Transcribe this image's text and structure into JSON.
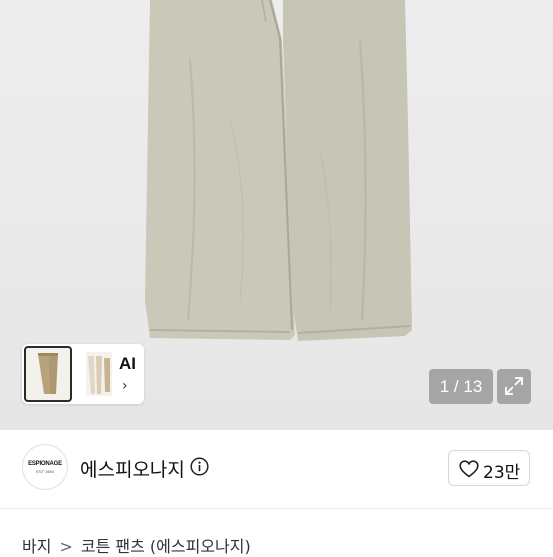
{
  "gallery": {
    "ai_card": {
      "label": "AI",
      "chevron": "›"
    },
    "counter": {
      "current": "1",
      "separator": " / ",
      "total": "13"
    },
    "expand_icon": "expand-icon"
  },
  "seller": {
    "logo_text": "ESPIONAGE",
    "logo_subtext": "EST 1984",
    "name": "에스피오나지",
    "info_icon": "info-icon",
    "like_icon": "heart-icon",
    "like_count": "23만"
  },
  "breadcrumb": {
    "items": [
      "바지",
      "코튼 팬츠 (에스피오나지)"
    ],
    "separator": ">"
  },
  "colors": {
    "pants": "#c9c8b9",
    "thumb_khaki": "#b7a27a",
    "counter_bg": "#8c8c8c"
  }
}
